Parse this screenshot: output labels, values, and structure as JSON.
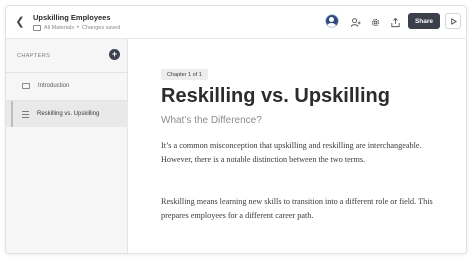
{
  "header": {
    "title": "Upskilling Employees",
    "breadcrumb": "All Materials",
    "separator": "•",
    "status": "Changes saved",
    "share_label": "Share"
  },
  "sidebar": {
    "section_label": "CHAPTERS",
    "add_label": "+",
    "items": [
      {
        "label": "Introduction",
        "active": false
      },
      {
        "label": "Reskilling vs. Upskilling",
        "active": true
      }
    ]
  },
  "main": {
    "chapter_badge": "Chapter 1 of 1",
    "title": "Reskilling vs. Upskilling",
    "subtitle": "What’s the Difference?",
    "paragraphs": [
      "It’s a common misconception that upskilling and reskilling are interchangeable. However, there is a notable distinction between the two terms.",
      "Reskilling means learning new skills to transition into a different role or field. This prepares employees for a different career path."
    ]
  },
  "colors": {
    "primary_button": "#3a3f4a",
    "sidebar_bg": "#f6f6f6",
    "active_item_bg": "#e9e9e9"
  },
  "icons": {
    "back": "chevron-left-icon",
    "folder": "folder-icon",
    "avatar": "user-avatar",
    "add_user": "add-user-icon",
    "settings": "gear-icon",
    "export": "export-icon",
    "play": "play-icon",
    "add_chapter": "plus-icon",
    "intro": "document-icon",
    "lesson": "list-icon"
  }
}
